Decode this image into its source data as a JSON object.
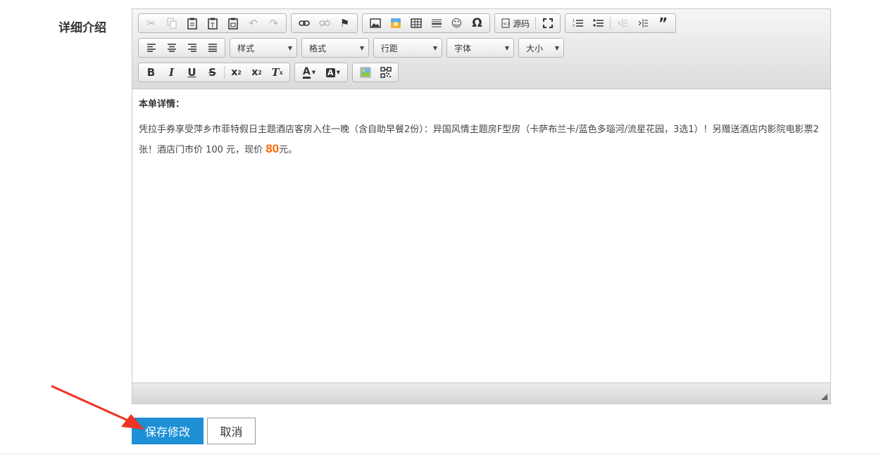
{
  "form": {
    "detail_label": "详细介绍",
    "save_label": "保存修改",
    "cancel_label": "取消"
  },
  "toolbar": {
    "source_label": "源码",
    "style_combo": "样式",
    "format_combo": "格式",
    "line_height_combo": "行距",
    "font_combo": "字体",
    "size_combo": "大小"
  },
  "content": {
    "heading": "本单详情：",
    "body_part1": "凭拉手券享受萍乡市菲特假日主题酒店客房入住一晚（含自助早餐2份）：异国风情主题房F型房（卡萨布兰卡/蓝色多瑙河/流星花园，3选1）！另赠送酒店内影院电影票2张！酒店门市价 100 元，现价 ",
    "price": "80",
    "body_part2": "元。"
  },
  "colors": {
    "primary_button": "#1e90d6",
    "price": "#ff6600",
    "arrow": "#ee3322"
  },
  "icons": [
    "cut-icon",
    "copy-icon",
    "paste-icon",
    "paste-text-icon",
    "paste-word-icon",
    "undo-icon",
    "redo-icon",
    "link-icon",
    "unlink-icon",
    "anchor-icon",
    "image-icon",
    "flash-icon",
    "table-icon",
    "horizontal-line-icon",
    "smiley-icon",
    "special-char-icon",
    "source-icon",
    "maximize-icon",
    "numbered-list-icon",
    "bulleted-list-icon",
    "outdent-icon",
    "indent-icon",
    "blockquote-icon",
    "align-left-icon",
    "align-center-icon",
    "align-right-icon",
    "align-justify-icon",
    "bold-icon",
    "italic-icon",
    "underline-icon",
    "strike-icon",
    "subscript-icon",
    "superscript-icon",
    "remove-format-icon",
    "text-color-icon",
    "bg-color-icon",
    "insert-image-icon",
    "qrcode-icon"
  ]
}
